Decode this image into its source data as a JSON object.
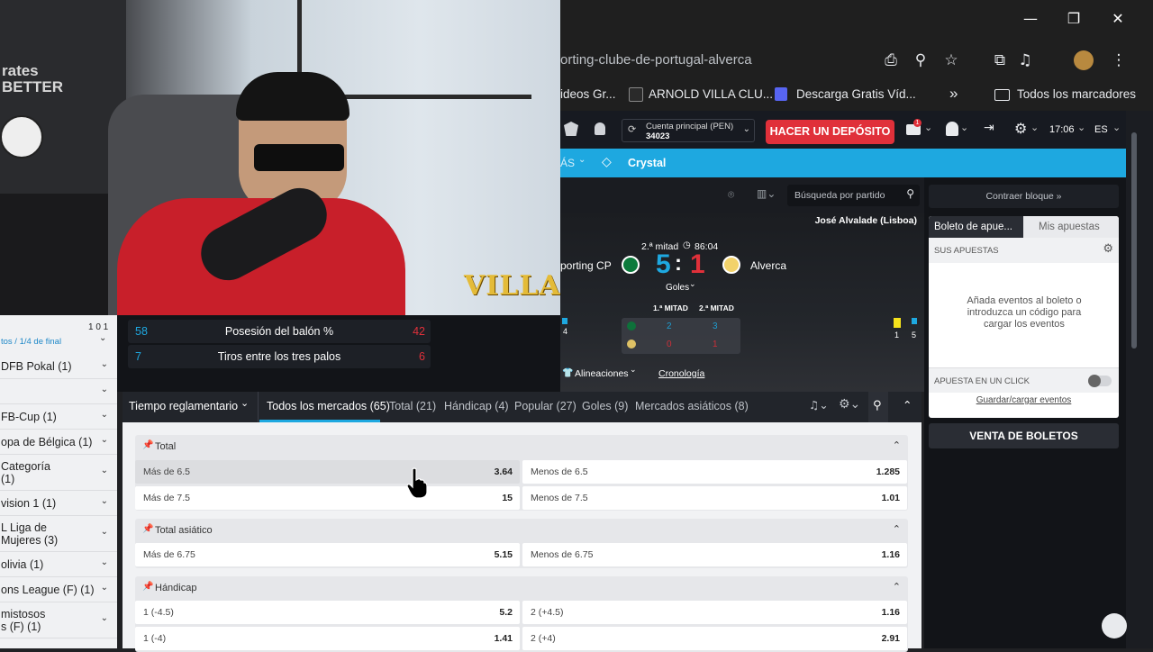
{
  "window": {
    "minimize": "—",
    "restore": "❐",
    "close": "✕"
  },
  "browser": {
    "url": "orting-clube-de-portugal-alverca",
    "icons": [
      "install-icon",
      "zoom-icon",
      "star-icon",
      "extensions-icon",
      "media-icon",
      "profile-avatar",
      "menu-icon"
    ],
    "bookmarks": [
      {
        "label": "ideos Gr..."
      },
      {
        "label": "ARNOLD VILLA CLU..."
      },
      {
        "label": "Descarga Gratis Víd..."
      }
    ],
    "more": "»",
    "all_bookmarks": "Todos los marcadores"
  },
  "header": {
    "account_label": "Cuenta principal  (PEN)",
    "account_number": "34023",
    "deposit_button": "HACER UN DEPÓSITO",
    "time": "17:06",
    "lang": "ES",
    "mail_badge": "1"
  },
  "nav": {
    "mas": "ÁS",
    "crystal": "Crystal"
  },
  "webcam": {
    "jersey_text": "rates BETTER",
    "logo": "VILLA"
  },
  "left_panel": {
    "top_num": "1 0 1",
    "breadcrumb": "tos / 1/4 de final",
    "items": [
      {
        "label": "DFB Pokal (1)"
      },
      {
        "label": ""
      },
      {
        "label": "FB-Cup (1)"
      },
      {
        "label": "opa de Bélgica (1)"
      },
      {
        "label": "Categoría\n(1)"
      },
      {
        "label": "vision 1 (1)"
      },
      {
        "label": "L Liga de\nMujeres (3)"
      },
      {
        "label": "olivia (1)"
      },
      {
        "label": "ons League (F) (1)"
      },
      {
        "label": "mistosos\ns (F) (1)"
      }
    ]
  },
  "match": {
    "search_placeholder": "Búsqueda por partido",
    "stadium": "José Alvalade (Lisboa)",
    "period": "2.ª mitad",
    "clock": "86:04",
    "home": "porting CP",
    "away": "Alverca",
    "home_score": "5",
    "away_score": "1",
    "separator": ":",
    "goals_dropdown": "Goles",
    "half1_label": "1.ª MITAD",
    "half2_label": "2.ª MITAD",
    "home_h1": "2",
    "home_h2": "3",
    "away_h1": "0",
    "away_h2": "1",
    "left_flag_count": "4",
    "yellow_count": "1",
    "right_flag_count": "5",
    "lineups": "Alineaciones",
    "timeline": "Cronología"
  },
  "stats": [
    {
      "home": "58",
      "label": "Posesión del balón %",
      "away": "42"
    },
    {
      "home": "7",
      "label": "Tiros entre los tres palos",
      "away": "6"
    }
  ],
  "markets_bar": {
    "time_select": "Tiempo reglamentario",
    "tabs": [
      {
        "label": "Todos los mercados (65)"
      },
      {
        "label": "Total (21)"
      },
      {
        "label": "Hándicap (4)"
      },
      {
        "label": "Popular (27)"
      },
      {
        "label": "Goles (9)"
      },
      {
        "label": "Mercados asiáticos (8)"
      }
    ]
  },
  "markets": [
    {
      "title": "Total",
      "rows": [
        [
          {
            "label": "Más de 6.5",
            "odd": "3.64"
          },
          {
            "label": "Menos de 6.5",
            "odd": "1.285"
          }
        ],
        [
          {
            "label": "Más de 7.5",
            "odd": "15"
          },
          {
            "label": "Menos de 7.5",
            "odd": "1.01"
          }
        ]
      ]
    },
    {
      "title": "Total asiático",
      "rows": [
        [
          {
            "label": "Más de 6.75",
            "odd": "5.15"
          },
          {
            "label": "Menos de 6.75",
            "odd": "1.16"
          }
        ]
      ]
    },
    {
      "title": "Hándicap",
      "rows": [
        [
          {
            "label": "1 (-4.5)",
            "odd": "5.2"
          },
          {
            "label": "2 (+4.5)",
            "odd": "1.16"
          }
        ],
        [
          {
            "label": "1 (-4)",
            "odd": "1.41"
          },
          {
            "label": "2 (+4)",
            "odd": "2.91"
          }
        ]
      ]
    }
  ],
  "betslip": {
    "contract": "Contraer bloque",
    "tab_slip": "Boleto de apue...",
    "tab_my": "Mis apuestas",
    "your_bets": "SUS APUESTAS",
    "empty_msg": "Añada eventos al boleto o introduzca un código para cargar los eventos",
    "one_click": "APUESTA EN UN CLICK",
    "save_load": "Guardar/cargar eventos",
    "sell_button": "VENTA DE BOLETOS"
  },
  "colors": {
    "accent": "#1ea8e0",
    "deposit": "#e0303a",
    "score_home": "#1ea8e0",
    "score_away": "#e0303a"
  }
}
